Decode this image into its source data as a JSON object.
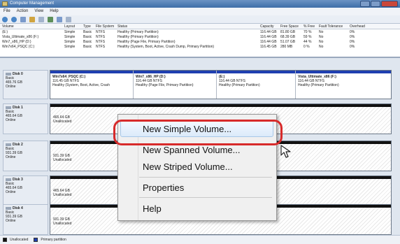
{
  "window": {
    "title": "Computer Management"
  },
  "menu": [
    "File",
    "Action",
    "View",
    "Help"
  ],
  "columns": [
    "Volume",
    "Layout",
    "Type",
    "File System",
    "Status",
    "Capacity",
    "Free Space",
    "% Free",
    "Fault Tolerance",
    "Overhead"
  ],
  "volumes": [
    {
      "name": "(E:)",
      "layout": "Simple",
      "type": "Basic",
      "fs": "NTFS",
      "status": "Healthy (Primary Partition)",
      "capacity": "116.44 GB",
      "free": "81.80 GB",
      "pct": "70 %",
      "fault": "No",
      "overhead": "0%"
    },
    {
      "name": "Vista_Ultimate_x86 (F:)",
      "layout": "Simple",
      "type": "Basic",
      "fs": "NTFS",
      "status": "Healthy (Primary Partition)",
      "capacity": "116.44 GB",
      "free": "68.39 GB",
      "pct": "59 %",
      "fault": "No",
      "overhead": "0%"
    },
    {
      "name": "Win7_x86_HP (D:)",
      "layout": "Simple",
      "type": "Basic",
      "fs": "NTFS",
      "status": "Healthy (Page File, Primary Partition)",
      "capacity": "116.44 GB",
      "free": "51.07 GB",
      "pct": "44 %",
      "fault": "No",
      "overhead": "0%"
    },
    {
      "name": "Win7x64_PSQC (C:)",
      "layout": "Simple",
      "type": "Basic",
      "fs": "NTFS",
      "status": "Healthy (System, Boot, Active, Crash Dump, Primary Partition)",
      "capacity": "116.45 GB",
      "free": "280 MB",
      "pct": "0 %",
      "fault": "No",
      "overhead": "0%"
    }
  ],
  "disks": [
    {
      "name": "Disk 0",
      "type": "Basic",
      "size": "465.76 GB",
      "state": "Online",
      "partitions": [
        {
          "name": "Win7x64_PSQC (C:)",
          "size": "116.45 GB NTFS",
          "status": "Healthy (System, Boot, Active, Crash"
        },
        {
          "name": "Win7_x86_HP (D:)",
          "size": "116.44 GB NTFS",
          "status": "Healthy (Page File, Primary Partition)"
        },
        {
          "name": "(E:)",
          "size": "116.44 GB NTFS",
          "status": "Healthy (Primary Partition)"
        },
        {
          "name": "Vista_Ultimate_x86 (F:)",
          "size": "116.44 GB NTFS",
          "status": "Healthy (Primary Partition)"
        }
      ]
    },
    {
      "name": "Disk 1",
      "type": "Basic",
      "size": "465.64 GB",
      "state": "Online",
      "unalloc_size": "465.64 GB",
      "unalloc_label": "Unallocated"
    },
    {
      "name": "Disk 2",
      "type": "Basic",
      "size": "931.39 GB",
      "state": "Online",
      "unalloc_size": "931.39 GB",
      "unalloc_label": "Unallocated"
    },
    {
      "name": "Disk 3",
      "type": "Basic",
      "size": "465.64 GB",
      "state": "Online",
      "unalloc_size": "465.64 GB",
      "unalloc_label": "Unallocated"
    },
    {
      "name": "Disk 4",
      "type": "Basic",
      "size": "931.39 GB",
      "state": "Online",
      "unalloc_size": "931.39 GB",
      "unalloc_label": "Unallocated"
    }
  ],
  "legend": {
    "unallocated": "Unallocated",
    "primary": "Primary partition"
  },
  "context_menu": {
    "new_simple": "New Simple Volume...",
    "new_spanned": "New Spanned Volume...",
    "new_striped": "New Striped Volume...",
    "properties": "Properties",
    "help": "Help"
  },
  "colors": {
    "primary_partition": "#1f3fb0",
    "unallocated": "#111111",
    "highlight_ring": "#d72a2a"
  }
}
